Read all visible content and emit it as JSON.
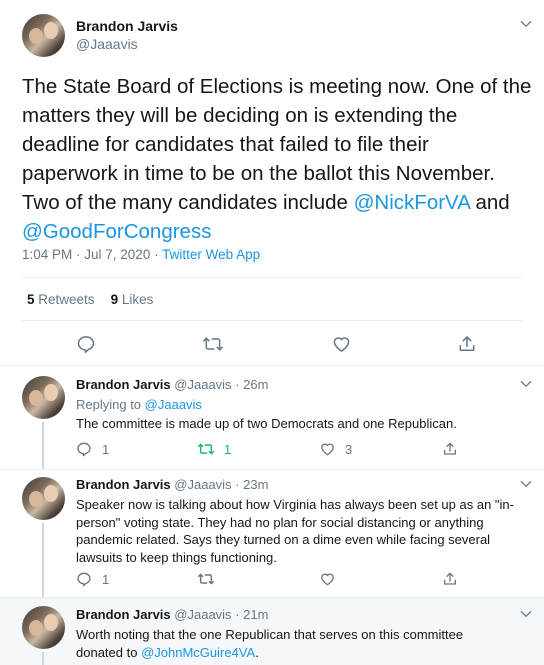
{
  "main_tweet": {
    "display_name": "Brandon Jarvis",
    "handle": "@Jaaavis",
    "text_lines": [
      "The State Board of Elections is meeting now. One of the",
      "matters they will be deciding on is extending the",
      "deadline for candidates that failed to file their",
      "paperwork in time to be on the ballot this November.",
      "Two of the many candidates include "
    ],
    "mention_1": "@NickForVA",
    "and_word": " and",
    "mention_2": "@GoodForCongress",
    "timestamp": "1:04 PM · Jul 7, 2020",
    "dot": " · ",
    "source": "Twitter Web App",
    "retweets_count": "5",
    "retweets_label": "Retweets",
    "likes_count": "9",
    "likes_label": "Likes",
    "action_icons": [
      "reply-icon",
      "retweet-icon",
      "like-icon",
      "share-icon"
    ]
  },
  "replies": [
    {
      "display_name": "Brandon Jarvis",
      "handle": "@Jaaavis",
      "time": " · 26m",
      "replying_to_label": "Replying to ",
      "replying_to": "@Jaaavis",
      "text": "The committee is made up of two Democrats and one Republican.",
      "reply_count": "1",
      "retweet_count": "1",
      "like_count": "3",
      "retweet_color": "#17bf63"
    },
    {
      "display_name": "Brandon Jarvis",
      "handle": "@Jaaavis",
      "time": " · 23m",
      "text_lines": [
        "Speaker now is talking about how Virginia has always been set up as an \"in-",
        "person\" voting state. They had no plan for social distancing or anything",
        "pandemic related. Says they turned on a dime even while facing several",
        "lawsuits to keep things functioning."
      ],
      "reply_count": "1"
    },
    {
      "display_name": "Brandon Jarvis",
      "handle": "@Jaaavis",
      "time": " · 21m",
      "text_line_1": "Worth noting that the one Republican that serves on this committee",
      "text_line_2_prefix": "donated to ",
      "mention": "@JohnMcGuire4VA",
      "text_line_2_suffix": "."
    }
  ],
  "colors": {
    "link": "#1b95e0",
    "muted": "#657786",
    "retweet_active": "#17bf63",
    "divider": "#e6ecf0"
  }
}
